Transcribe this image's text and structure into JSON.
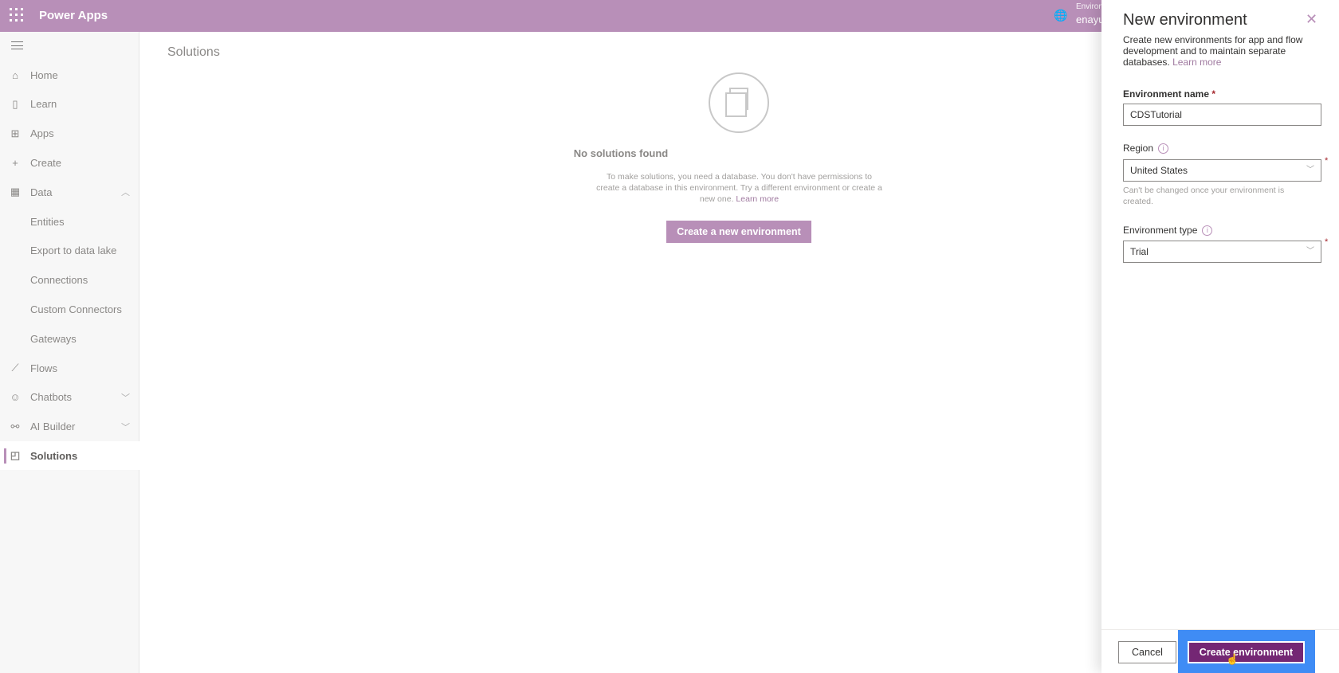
{
  "header": {
    "app_name": "Power Apps",
    "environment_label": "Environ",
    "environment_name": "enayu"
  },
  "sidebar": {
    "items": [
      {
        "label": "Home",
        "icon": "home-icon",
        "glyph": "⌂"
      },
      {
        "label": "Learn",
        "icon": "book-icon",
        "glyph": "▯"
      },
      {
        "label": "Apps",
        "icon": "apps-icon",
        "glyph": "⊞"
      },
      {
        "label": "Create",
        "icon": "plus-icon",
        "glyph": "+"
      },
      {
        "label": "Data",
        "icon": "table-icon",
        "glyph": "▦",
        "chevron": "up"
      },
      {
        "label": "Entities"
      },
      {
        "label": "Export to data lake"
      },
      {
        "label": "Connections"
      },
      {
        "label": "Custom Connectors"
      },
      {
        "label": "Gateways"
      },
      {
        "label": "Flows",
        "icon": "flow-icon",
        "glyph": "⟋"
      },
      {
        "label": "Chatbots",
        "icon": "bot-icon",
        "glyph": "☺",
        "chevron": "down"
      },
      {
        "label": "AI Builder",
        "icon": "ai-icon",
        "glyph": "⚯",
        "chevron": "down"
      },
      {
        "label": "Solutions",
        "icon": "solutions-icon",
        "glyph": "◰",
        "active": true
      }
    ]
  },
  "main": {
    "title": "Solutions",
    "empty_title": "No solutions found",
    "empty_desc": "To make solutions, you need a database. You don't have permissions to create a database in this environment. Try a different environment or create a new one.",
    "learn_more": "Learn more",
    "cta": "Create a new environment"
  },
  "panel": {
    "title": "New environment",
    "description": "Create new environments for app and flow development and to maintain separate databases.",
    "learn_more": "Learn more",
    "name_label": "Environment name",
    "name_value": "CDSTutorial",
    "region_label": "Region",
    "region_value": "United States",
    "region_help": "Can't be changed once your environment is created.",
    "type_label": "Environment type",
    "type_value": "Trial",
    "required_mark": "*",
    "cancel": "Cancel",
    "create": "Create environment"
  },
  "colors": {
    "brand": "#b88fb8",
    "primary": "#742774",
    "highlight": "#3f8cf5"
  }
}
